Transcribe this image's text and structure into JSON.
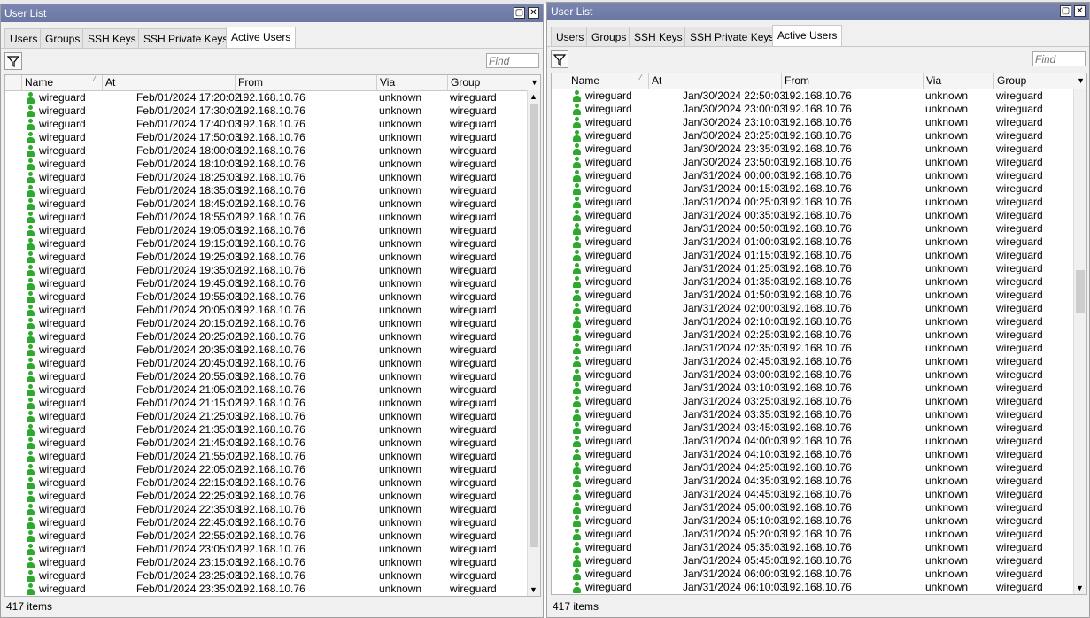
{
  "windows": [
    {
      "title": "User List",
      "tabs": [
        "Users",
        "Groups",
        "SSH Keys",
        "SSH Private Keys",
        "Active Users"
      ],
      "active_tab": "Active Users",
      "find_placeholder": "Find",
      "columns": [
        "Name",
        "At",
        "From",
        "Via",
        "Group"
      ],
      "status": "417 items",
      "rows": [
        [
          "wireguard",
          "Feb/01/2024 17:20:02",
          "192.168.10.76",
          "unknown",
          "wireguard"
        ],
        [
          "wireguard",
          "Feb/01/2024 17:30:02",
          "192.168.10.76",
          "unknown",
          "wireguard"
        ],
        [
          "wireguard",
          "Feb/01/2024 17:40:03",
          "192.168.10.76",
          "unknown",
          "wireguard"
        ],
        [
          "wireguard",
          "Feb/01/2024 17:50:03",
          "192.168.10.76",
          "unknown",
          "wireguard"
        ],
        [
          "wireguard",
          "Feb/01/2024 18:00:03",
          "192.168.10.76",
          "unknown",
          "wireguard"
        ],
        [
          "wireguard",
          "Feb/01/2024 18:10:03",
          "192.168.10.76",
          "unknown",
          "wireguard"
        ],
        [
          "wireguard",
          "Feb/01/2024 18:25:03",
          "192.168.10.76",
          "unknown",
          "wireguard"
        ],
        [
          "wireguard",
          "Feb/01/2024 18:35:03",
          "192.168.10.76",
          "unknown",
          "wireguard"
        ],
        [
          "wireguard",
          "Feb/01/2024 18:45:02",
          "192.168.10.76",
          "unknown",
          "wireguard"
        ],
        [
          "wireguard",
          "Feb/01/2024 18:55:02",
          "192.168.10.76",
          "unknown",
          "wireguard"
        ],
        [
          "wireguard",
          "Feb/01/2024 19:05:03",
          "192.168.10.76",
          "unknown",
          "wireguard"
        ],
        [
          "wireguard",
          "Feb/01/2024 19:15:03",
          "192.168.10.76",
          "unknown",
          "wireguard"
        ],
        [
          "wireguard",
          "Feb/01/2024 19:25:03",
          "192.168.10.76",
          "unknown",
          "wireguard"
        ],
        [
          "wireguard",
          "Feb/01/2024 19:35:02",
          "192.168.10.76",
          "unknown",
          "wireguard"
        ],
        [
          "wireguard",
          "Feb/01/2024 19:45:03",
          "192.168.10.76",
          "unknown",
          "wireguard"
        ],
        [
          "wireguard",
          "Feb/01/2024 19:55:03",
          "192.168.10.76",
          "unknown",
          "wireguard"
        ],
        [
          "wireguard",
          "Feb/01/2024 20:05:03",
          "192.168.10.76",
          "unknown",
          "wireguard"
        ],
        [
          "wireguard",
          "Feb/01/2024 20:15:02",
          "192.168.10.76",
          "unknown",
          "wireguard"
        ],
        [
          "wireguard",
          "Feb/01/2024 20:25:02",
          "192.168.10.76",
          "unknown",
          "wireguard"
        ],
        [
          "wireguard",
          "Feb/01/2024 20:35:03",
          "192.168.10.76",
          "unknown",
          "wireguard"
        ],
        [
          "wireguard",
          "Feb/01/2024 20:45:03",
          "192.168.10.76",
          "unknown",
          "wireguard"
        ],
        [
          "wireguard",
          "Feb/01/2024 20:55:03",
          "192.168.10.76",
          "unknown",
          "wireguard"
        ],
        [
          "wireguard",
          "Feb/01/2024 21:05:02",
          "192.168.10.76",
          "unknown",
          "wireguard"
        ],
        [
          "wireguard",
          "Feb/01/2024 21:15:02",
          "192.168.10.76",
          "unknown",
          "wireguard"
        ],
        [
          "wireguard",
          "Feb/01/2024 21:25:03",
          "192.168.10.76",
          "unknown",
          "wireguard"
        ],
        [
          "wireguard",
          "Feb/01/2024 21:35:03",
          "192.168.10.76",
          "unknown",
          "wireguard"
        ],
        [
          "wireguard",
          "Feb/01/2024 21:45:03",
          "192.168.10.76",
          "unknown",
          "wireguard"
        ],
        [
          "wireguard",
          "Feb/01/2024 21:55:02",
          "192.168.10.76",
          "unknown",
          "wireguard"
        ],
        [
          "wireguard",
          "Feb/01/2024 22:05:02",
          "192.168.10.76",
          "unknown",
          "wireguard"
        ],
        [
          "wireguard",
          "Feb/01/2024 22:15:03",
          "192.168.10.76",
          "unknown",
          "wireguard"
        ],
        [
          "wireguard",
          "Feb/01/2024 22:25:03",
          "192.168.10.76",
          "unknown",
          "wireguard"
        ],
        [
          "wireguard",
          "Feb/01/2024 22:35:03",
          "192.168.10.76",
          "unknown",
          "wireguard"
        ],
        [
          "wireguard",
          "Feb/01/2024 22:45:03",
          "192.168.10.76",
          "unknown",
          "wireguard"
        ],
        [
          "wireguard",
          "Feb/01/2024 22:55:02",
          "192.168.10.76",
          "unknown",
          "wireguard"
        ],
        [
          "wireguard",
          "Feb/01/2024 23:05:02",
          "192.168.10.76",
          "unknown",
          "wireguard"
        ],
        [
          "wireguard",
          "Feb/01/2024 23:15:03",
          "192.168.10.76",
          "unknown",
          "wireguard"
        ],
        [
          "wireguard",
          "Feb/01/2024 23:25:03",
          "192.168.10.76",
          "unknown",
          "wireguard"
        ],
        [
          "wireguard",
          "Feb/01/2024 23:35:02",
          "192.168.10.76",
          "unknown",
          "wireguard"
        ]
      ]
    },
    {
      "title": "User List",
      "tabs": [
        "Users",
        "Groups",
        "SSH Keys",
        "SSH Private Keys",
        "Active Users"
      ],
      "active_tab": "Active Users",
      "find_placeholder": "Find",
      "columns": [
        "Name",
        "At",
        "From",
        "Via",
        "Group"
      ],
      "status": "417 items",
      "rows": [
        [
          "wireguard",
          "Jan/30/2024 22:50:03",
          "192.168.10.76",
          "unknown",
          "wireguard"
        ],
        [
          "wireguard",
          "Jan/30/2024 23:00:03",
          "192.168.10.76",
          "unknown",
          "wireguard"
        ],
        [
          "wireguard",
          "Jan/30/2024 23:10:03",
          "192.168.10.76",
          "unknown",
          "wireguard"
        ],
        [
          "wireguard",
          "Jan/30/2024 23:25:03",
          "192.168.10.76",
          "unknown",
          "wireguard"
        ],
        [
          "wireguard",
          "Jan/30/2024 23:35:03",
          "192.168.10.76",
          "unknown",
          "wireguard"
        ],
        [
          "wireguard",
          "Jan/30/2024 23:50:03",
          "192.168.10.76",
          "unknown",
          "wireguard"
        ],
        [
          "wireguard",
          "Jan/31/2024 00:00:03",
          "192.168.10.76",
          "unknown",
          "wireguard"
        ],
        [
          "wireguard",
          "Jan/31/2024 00:15:03",
          "192.168.10.76",
          "unknown",
          "wireguard"
        ],
        [
          "wireguard",
          "Jan/31/2024 00:25:03",
          "192.168.10.76",
          "unknown",
          "wireguard"
        ],
        [
          "wireguard",
          "Jan/31/2024 00:35:03",
          "192.168.10.76",
          "unknown",
          "wireguard"
        ],
        [
          "wireguard",
          "Jan/31/2024 00:50:03",
          "192.168.10.76",
          "unknown",
          "wireguard"
        ],
        [
          "wireguard",
          "Jan/31/2024 01:00:03",
          "192.168.10.76",
          "unknown",
          "wireguard"
        ],
        [
          "wireguard",
          "Jan/31/2024 01:15:03",
          "192.168.10.76",
          "unknown",
          "wireguard"
        ],
        [
          "wireguard",
          "Jan/31/2024 01:25:03",
          "192.168.10.76",
          "unknown",
          "wireguard"
        ],
        [
          "wireguard",
          "Jan/31/2024 01:35:03",
          "192.168.10.76",
          "unknown",
          "wireguard"
        ],
        [
          "wireguard",
          "Jan/31/2024 01:50:03",
          "192.168.10.76",
          "unknown",
          "wireguard"
        ],
        [
          "wireguard",
          "Jan/31/2024 02:00:03",
          "192.168.10.76",
          "unknown",
          "wireguard"
        ],
        [
          "wireguard",
          "Jan/31/2024 02:10:03",
          "192.168.10.76",
          "unknown",
          "wireguard"
        ],
        [
          "wireguard",
          "Jan/31/2024 02:25:03",
          "192.168.10.76",
          "unknown",
          "wireguard"
        ],
        [
          "wireguard",
          "Jan/31/2024 02:35:03",
          "192.168.10.76",
          "unknown",
          "wireguard"
        ],
        [
          "wireguard",
          "Jan/31/2024 02:45:03",
          "192.168.10.76",
          "unknown",
          "wireguard"
        ],
        [
          "wireguard",
          "Jan/31/2024 03:00:03",
          "192.168.10.76",
          "unknown",
          "wireguard"
        ],
        [
          "wireguard",
          "Jan/31/2024 03:10:03",
          "192.168.10.76",
          "unknown",
          "wireguard"
        ],
        [
          "wireguard",
          "Jan/31/2024 03:25:03",
          "192.168.10.76",
          "unknown",
          "wireguard"
        ],
        [
          "wireguard",
          "Jan/31/2024 03:35:03",
          "192.168.10.76",
          "unknown",
          "wireguard"
        ],
        [
          "wireguard",
          "Jan/31/2024 03:45:03",
          "192.168.10.76",
          "unknown",
          "wireguard"
        ],
        [
          "wireguard",
          "Jan/31/2024 04:00:03",
          "192.168.10.76",
          "unknown",
          "wireguard"
        ],
        [
          "wireguard",
          "Jan/31/2024 04:10:03",
          "192.168.10.76",
          "unknown",
          "wireguard"
        ],
        [
          "wireguard",
          "Jan/31/2024 04:25:03",
          "192.168.10.76",
          "unknown",
          "wireguard"
        ],
        [
          "wireguard",
          "Jan/31/2024 04:35:03",
          "192.168.10.76",
          "unknown",
          "wireguard"
        ],
        [
          "wireguard",
          "Jan/31/2024 04:45:03",
          "192.168.10.76",
          "unknown",
          "wireguard"
        ],
        [
          "wireguard",
          "Jan/31/2024 05:00:03",
          "192.168.10.76",
          "unknown",
          "wireguard"
        ],
        [
          "wireguard",
          "Jan/31/2024 05:10:03",
          "192.168.10.76",
          "unknown",
          "wireguard"
        ],
        [
          "wireguard",
          "Jan/31/2024 05:20:03",
          "192.168.10.76",
          "unknown",
          "wireguard"
        ],
        [
          "wireguard",
          "Jan/31/2024 05:35:03",
          "192.168.10.76",
          "unknown",
          "wireguard"
        ],
        [
          "wireguard",
          "Jan/31/2024 05:45:03",
          "192.168.10.76",
          "unknown",
          "wireguard"
        ],
        [
          "wireguard",
          "Jan/31/2024 06:00:03",
          "192.168.10.76",
          "unknown",
          "wireguard"
        ],
        [
          "wireguard",
          "Jan/31/2024 06:10:03",
          "192.168.10.76",
          "unknown",
          "wireguard"
        ]
      ]
    }
  ],
  "colors": {
    "titlebar": "#6b77a4",
    "user_icon": "#2fa82f"
  }
}
